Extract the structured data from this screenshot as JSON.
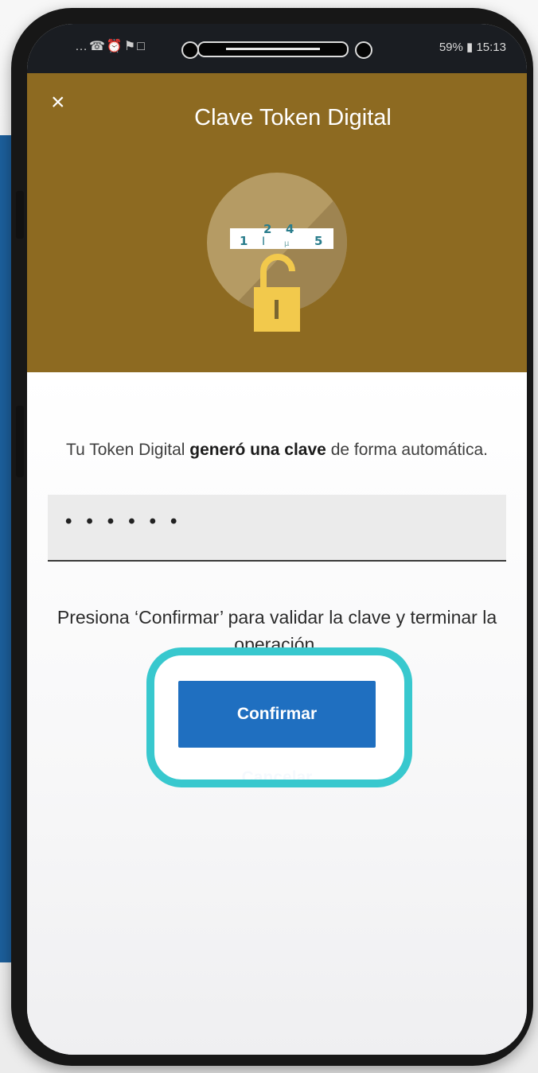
{
  "statusbar": {
    "left_icons": "…☎⏰⚑□",
    "right": "59% ▮ 15:13"
  },
  "header": {
    "close_icon": "close-icon",
    "close_symbol": "×",
    "title": "Clave Token Digital"
  },
  "illustration": {
    "digits": [
      "1",
      "2",
      "4",
      "5"
    ]
  },
  "info": {
    "prefix": "Tu Token Digital ",
    "bold": "generó una clave",
    "suffix": " de forma automática."
  },
  "token_field": {
    "value": "••••••"
  },
  "instruction": "Presiona ‘Confirmar’ para validar la clave y terminar la operación.",
  "buttons": {
    "confirm": "Confirmar",
    "cancel": "Cancelar"
  },
  "colors": {
    "header_gold": "#8d6a21",
    "primary_blue": "#1f6fc0",
    "highlight_teal": "#38c8ce",
    "lock_yellow": "#f2c94c"
  }
}
